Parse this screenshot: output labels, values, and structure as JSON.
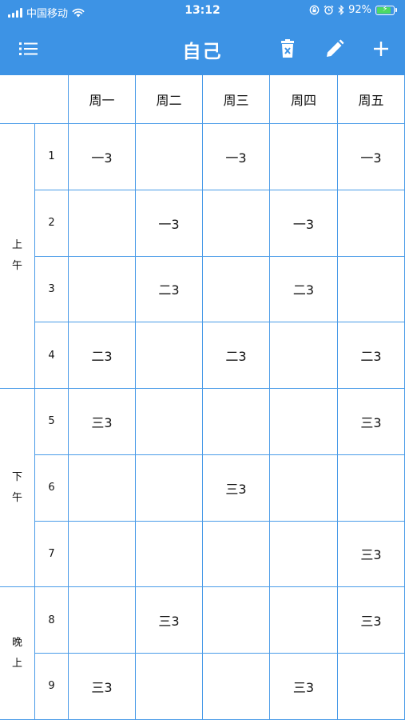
{
  "status_bar": {
    "carrier": "中国移动",
    "time": "13:12",
    "battery_percent": "92%",
    "battery_level": 0.92,
    "icons": [
      "signal-icon",
      "wifi-icon",
      "lock-rotation-icon",
      "alarm-icon",
      "bluetooth-icon",
      "battery-charging-icon"
    ]
  },
  "nav": {
    "title": "自己",
    "menu_icon": "list-icon",
    "delete_icon": "trash-icon",
    "edit_icon": "pencil-icon",
    "add_icon": "plus-icon"
  },
  "colors": {
    "accent": "#3d93e5",
    "grid_line": "#4a9be8"
  },
  "timetable": {
    "days": [
      "周一",
      "周二",
      "周三",
      "周四",
      "周五"
    ],
    "sections": [
      {
        "chars": [
          "上",
          "午"
        ],
        "periods": [
          1,
          2,
          3,
          4
        ]
      },
      {
        "chars": [
          "下",
          "午"
        ],
        "periods": [
          5,
          6,
          7
        ]
      },
      {
        "chars": [
          "晚",
          "上"
        ],
        "periods": [
          8,
          9
        ]
      }
    ],
    "period_numbers": [
      "1",
      "2",
      "3",
      "4",
      "5",
      "6",
      "7",
      "8",
      "9"
    ],
    "rows": [
      [
        "一3",
        "",
        "一3",
        "",
        "一3"
      ],
      [
        "",
        "一3",
        "",
        "一3",
        ""
      ],
      [
        "",
        "二3",
        "",
        "二3",
        ""
      ],
      [
        "二3",
        "",
        "二3",
        "",
        "二3"
      ],
      [
        "三3",
        "",
        "",
        "",
        "三3"
      ],
      [
        "",
        "",
        "三3",
        "",
        ""
      ],
      [
        "",
        "",
        "",
        "",
        "三3"
      ],
      [
        "",
        "三3",
        "",
        "",
        "三3"
      ],
      [
        "三3",
        "",
        "",
        "三3",
        ""
      ]
    ]
  }
}
